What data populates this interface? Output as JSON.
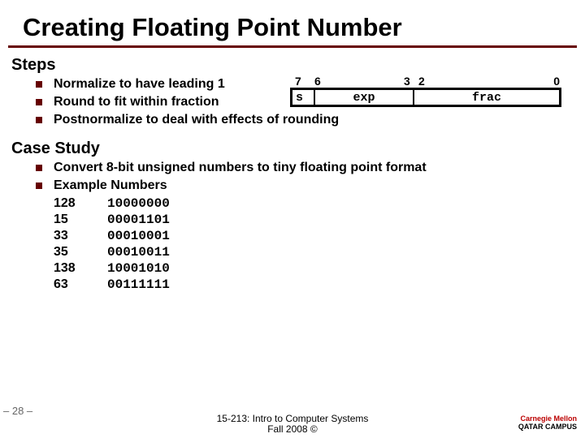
{
  "title": "Creating Floating Point Number",
  "sections": {
    "steps_heading": "Steps",
    "case_heading": "Case Study"
  },
  "steps": [
    "Normalize to have leading 1",
    "Round to fit within fraction",
    "Postnormalize to deal with effects of rounding"
  ],
  "case": {
    "intro": "Convert 8-bit unsigned numbers to tiny floating point format",
    "examples_label": "Example Numbers",
    "rows": [
      {
        "dec": "128",
        "bin": "10000000"
      },
      {
        "dec": "15",
        "bin": "00001101"
      },
      {
        "dec": "33",
        "bin": "00010001"
      },
      {
        "dec": "35",
        "bin": "00010011"
      },
      {
        "dec": "138",
        "bin": "10001010"
      },
      {
        "dec": "63",
        "bin": "00111111"
      }
    ]
  },
  "format_diagram": {
    "bit_labels": {
      "a": "7",
      "b": "6",
      "c": "3",
      "d": "2",
      "e": "0"
    },
    "s": "s",
    "exp": "exp",
    "frac": "frac"
  },
  "footer": {
    "page": "– 28 –",
    "course1": "15-213: Intro to Computer Systems",
    "course2": "Fall 2008 ©",
    "logo1": "Carnegie Mellon",
    "logo2": "QATAR CAMPUS"
  }
}
